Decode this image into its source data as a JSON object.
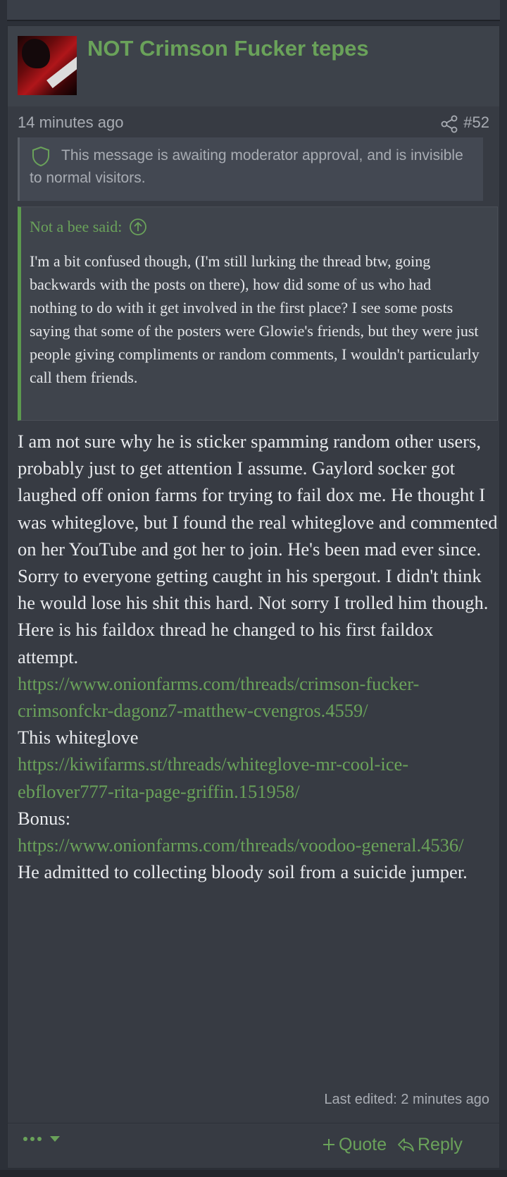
{
  "post": {
    "username": "NOT Crimson Fucker tepes",
    "timestamp": "14 minutes ago",
    "number": "#52",
    "moderation_notice": "This message is awaiting moderator approval, and is invisible to normal visitors.",
    "quote": {
      "author": "Not a bee said:",
      "text": "I'm a bit confused though, (I'm still lurking the thread btw, going backwards with the posts on there), how did some of us who had nothing to do with it get involved in the first place? I see some posts saying that some of the posters were Glowie's friends, but they were just people giving compliments or random comments, I wouldn't particularly call them friends."
    },
    "body": {
      "paragraph1": "I am not sure why he is sticker spamming random other users, probably just to get attention I assume. Gaylord socker got laughed off onion farms for trying to fail dox me. He thought I was whiteglove, but I found the real whiteglove and commented on her YouTube and got her to join. He's been mad ever since. Sorry to everyone getting caught in his spergout. I didn't think he would lose his shit this hard. Not sorry I trolled him though.",
      "paragraph2": "Here is his faildox thread he changed to his first faildox attempt.",
      "link1": "https://www.onionfarms.com/threads/crimson-fucker-crimsonfckr-dagonz7-matthew-cvengros.4559/",
      "paragraph3": "This whiteglove",
      "link2": "https://kiwifarms.st/threads/whiteglove-mr-cool-ice-ebflover777-rita-page-griffin.151958/",
      "paragraph4": "Bonus:",
      "link3": "https://www.onionfarms.com/threads/voodoo-general.4536/",
      "paragraph5": "He admitted to collecting bloody soil from a suicide jumper."
    },
    "last_edited": "Last edited: 2 minutes ago",
    "actions": {
      "quote_label": "Quote",
      "reply_label": "Reply"
    }
  },
  "colors": {
    "accent": "#6aa25a",
    "background": "#2c3038",
    "post_background": "#373b43"
  },
  "icons": [
    "share-icon",
    "shield-icon",
    "arrow-up-circle-icon",
    "more-dots-icon",
    "plus-icon",
    "reply-arrow-icon"
  ]
}
